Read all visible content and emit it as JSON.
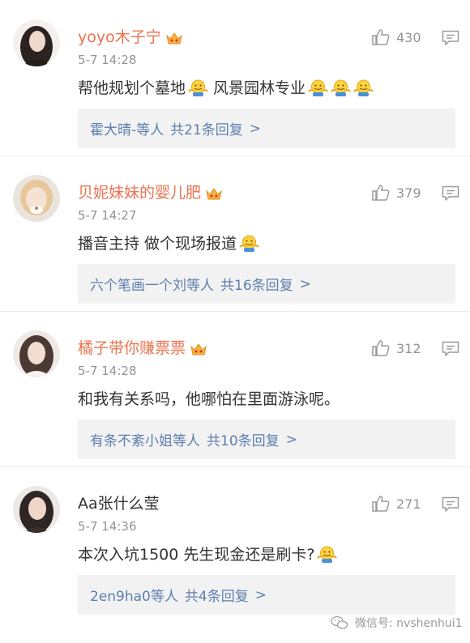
{
  "comments": [
    {
      "username": "yoyo木子宁",
      "vip": true,
      "time": "5-7 14:28",
      "likes": "430",
      "text": "帮他规划个墓地",
      "text2": "风景园林专业",
      "emoji_after_text": 1,
      "emoji_after_text2": 3,
      "reply_users": "霍大晴-等人",
      "reply_count": "共21条回复",
      "reply_arrow": ">"
    },
    {
      "username": "贝妮妹妹的婴儿肥",
      "vip": true,
      "time": "5-7 14:27",
      "likes": "379",
      "text": "播音主持 做个现场报道",
      "text2": "",
      "emoji_after_text": 1,
      "emoji_after_text2": 0,
      "reply_users": "六个笔画一个刘等人",
      "reply_count": "共16条回复",
      "reply_arrow": ">"
    },
    {
      "username": "橘子带你赚票票",
      "vip": true,
      "time": "5-7 14:28",
      "likes": "312",
      "text": "和我有关系吗，他哪怕在里面游泳呢。",
      "text2": "",
      "emoji_after_text": 0,
      "emoji_after_text2": 0,
      "reply_users": "有条不紊小姐等人",
      "reply_count": "共10条回复",
      "reply_arrow": ">"
    },
    {
      "username": "Aa张什么莹",
      "vip": false,
      "time": "5-7 14:36",
      "likes": "271",
      "text": "本次入坑1500 先生现金还是刷卡?",
      "text2": "",
      "emoji_after_text": 1,
      "emoji_after_text2": 0,
      "reply_users": "2en9ha0等人",
      "reply_count": "共4条回复",
      "reply_arrow": ">"
    }
  ],
  "icons": {
    "like": "thumbs-up-icon",
    "reply": "comment-bubble-icon",
    "crown": "vip-crown-icon",
    "emoji": "shrug-emoji-icon",
    "watermark": "wechat-icon"
  },
  "colors": {
    "vip_name": "#eb7350",
    "link": "#5d7fae",
    "meta": "#939393",
    "reply_bg": "#f2f2f2"
  },
  "watermark": "微信号: nvshenhui1"
}
